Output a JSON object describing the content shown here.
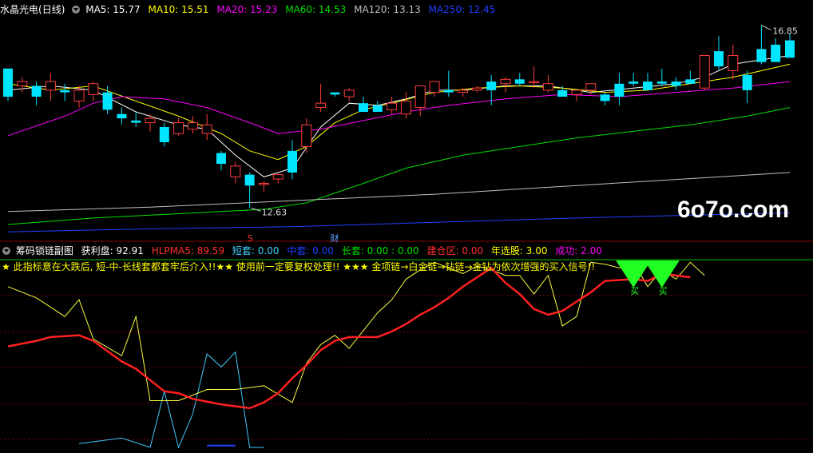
{
  "main_header": {
    "stock": "水晶光电",
    "period": "(日线)",
    "ma": [
      {
        "label": "MA5: 15.77",
        "color": "#ffffff"
      },
      {
        "label": "MA10: 15.51",
        "color": "#ffff00"
      },
      {
        "label": "MA20: 15.23",
        "color": "#ff00ff"
      },
      {
        "label": "MA60: 14.53",
        "color": "#00e000"
      },
      {
        "label": "MA120: 13.13",
        "color": "#c0c0c0"
      },
      {
        "label": "MA250: 12.45",
        "color": "#2040ff"
      }
    ]
  },
  "sub_header": {
    "name": "筹码锁链副图",
    "items": [
      {
        "label": "获利盘: 92.91",
        "color": "#ffffff"
      },
      {
        "label": "HLPMA5: 89.59",
        "color": "#ff3030"
      },
      {
        "label": "短套: 0.00",
        "color": "#40d0ff"
      },
      {
        "label": "中套: 0.00",
        "color": "#2040ff"
      },
      {
        "label": "长套: 0.00 : 0.00",
        "color": "#00e000"
      },
      {
        "label": "建仓区: 0.00",
        "color": "#ff3030"
      },
      {
        "label": "年选股: 3.00",
        "color": "#ffff00"
      },
      {
        "label": "成功: 2.00",
        "color": "#ff00ff"
      }
    ]
  },
  "note": "★ 此指标意在大跌后, 短-中-长线套都套牢后介入!!★★ 使用前一定要复权处理!! ★★★ 金项链→白金链→钻链→金钻为依次增强的买入信号!!",
  "watermark": "6o7o.com",
  "markers": {
    "s": "S",
    "cai": "财",
    "buy": "买"
  },
  "chart_data": {
    "type": "candlestick",
    "price_range": [
      11.9,
      17.1
    ],
    "annotations": {
      "high": "16.85",
      "low": "12.63"
    },
    "candles": [
      [
        15.85,
        15.85,
        15.1,
        15.2
      ],
      [
        15.45,
        15.65,
        15.3,
        15.55
      ],
      [
        15.45,
        15.55,
        15.0,
        15.2
      ],
      [
        15.35,
        15.75,
        15.1,
        15.55
      ],
      [
        15.35,
        15.5,
        15.1,
        15.3
      ],
      [
        15.1,
        15.45,
        14.95,
        15.35
      ],
      [
        15.25,
        15.55,
        15.1,
        15.5
      ],
      [
        15.3,
        15.45,
        14.8,
        14.9
      ],
      [
        14.8,
        14.95,
        14.55,
        14.7
      ],
      [
        14.65,
        14.85,
        14.5,
        14.6
      ],
      [
        14.6,
        14.8,
        14.4,
        14.7
      ],
      [
        14.5,
        14.6,
        14.05,
        14.15
      ],
      [
        14.35,
        14.7,
        14.3,
        14.6
      ],
      [
        14.45,
        14.75,
        14.35,
        14.6
      ],
      [
        14.35,
        14.8,
        14.2,
        14.55
      ],
      [
        13.9,
        13.95,
        13.5,
        13.65
      ],
      [
        13.35,
        13.7,
        13.2,
        13.6
      ],
      [
        13.4,
        13.45,
        12.63,
        13.15
      ],
      [
        13.2,
        13.25,
        13.0,
        13.2
      ],
      [
        13.3,
        13.45,
        13.2,
        13.4
      ],
      [
        13.95,
        14.2,
        13.3,
        13.45
      ],
      [
        14.05,
        14.7,
        13.9,
        14.55
      ],
      [
        14.95,
        15.5,
        14.85,
        15.05
      ],
      [
        15.3,
        15.3,
        15.2,
        15.25
      ],
      [
        15.2,
        15.4,
        15.1,
        15.35
      ],
      [
        15.05,
        15.2,
        14.9,
        14.85
      ],
      [
        15.0,
        15.1,
        14.95,
        14.85
      ],
      [
        14.9,
        15.2,
        14.8,
        15.05
      ],
      [
        14.8,
        15.3,
        14.7,
        15.1
      ],
      [
        14.95,
        15.35,
        14.75,
        15.45
      ],
      [
        15.3,
        15.55,
        15.2,
        15.55
      ],
      [
        15.35,
        15.8,
        15.2,
        15.3
      ],
      [
        15.3,
        15.4,
        15.2,
        15.35
      ],
      [
        15.35,
        15.45,
        15.3,
        15.4
      ],
      [
        15.55,
        15.7,
        15.0,
        15.35
      ],
      [
        15.5,
        15.65,
        15.3,
        15.6
      ],
      [
        15.6,
        15.75,
        15.45,
        15.5
      ],
      [
        15.55,
        15.9,
        15.4,
        15.55
      ],
      [
        15.35,
        15.7,
        15.3,
        15.5
      ],
      [
        15.35,
        15.45,
        15.2,
        15.2
      ],
      [
        15.25,
        15.35,
        15.1,
        15.35
      ],
      [
        15.35,
        15.4,
        15.25,
        15.5
      ],
      [
        15.25,
        15.3,
        15.0,
        15.1
      ],
      [
        15.5,
        15.75,
        15.0,
        15.2
      ],
      [
        15.55,
        15.75,
        15.45,
        15.5
      ],
      [
        15.55,
        15.75,
        15.4,
        15.35
      ],
      [
        15.55,
        15.85,
        15.45,
        15.5
      ],
      [
        15.55,
        15.65,
        15.35,
        15.45
      ],
      [
        15.6,
        15.8,
        15.55,
        15.5
      ],
      [
        15.4,
        15.7,
        15.35,
        16.15
      ],
      [
        16.25,
        16.6,
        15.8,
        15.9
      ],
      [
        15.8,
        16.4,
        15.6,
        16.15
      ],
      [
        15.7,
        15.8,
        15.05,
        15.35
      ],
      [
        16.3,
        16.85,
        15.95,
        16.0
      ],
      [
        16.4,
        16.55,
        16.05,
        16.0
      ],
      [
        16.5,
        16.65,
        16.2,
        16.1
      ]
    ],
    "ma_lines": {
      "MA5": [
        [
          0,
          15.35
        ],
        [
          3,
          15.45
        ],
        [
          6,
          15.35
        ],
        [
          9,
          14.85
        ],
        [
          12,
          14.55
        ],
        [
          14,
          14.45
        ],
        [
          16,
          13.85
        ],
        [
          18,
          13.35
        ],
        [
          20,
          13.55
        ],
        [
          22,
          14.5
        ],
        [
          24,
          15.05
        ],
        [
          26,
          15.0
        ],
        [
          28,
          15.15
        ],
        [
          30,
          15.35
        ],
        [
          32,
          15.35
        ],
        [
          35,
          15.45
        ],
        [
          38,
          15.45
        ],
        [
          41,
          15.3
        ],
        [
          44,
          15.4
        ],
        [
          47,
          15.5
        ],
        [
          49,
          15.65
        ],
        [
          51,
          15.95
        ],
        [
          53,
          16.05
        ],
        [
          55,
          16.15
        ]
      ],
      "MA10": [
        [
          0,
          15.5
        ],
        [
          3,
          15.35
        ],
        [
          6,
          15.45
        ],
        [
          9,
          15.1
        ],
        [
          12,
          14.75
        ],
        [
          15,
          14.35
        ],
        [
          17,
          13.95
        ],
        [
          19,
          13.75
        ],
        [
          21,
          14.05
        ],
        [
          23,
          14.6
        ],
        [
          25,
          14.9
        ],
        [
          27,
          15.05
        ],
        [
          30,
          15.3
        ],
        [
          33,
          15.4
        ],
        [
          36,
          15.45
        ],
        [
          39,
          15.4
        ],
        [
          42,
          15.3
        ],
        [
          45,
          15.35
        ],
        [
          48,
          15.5
        ],
        [
          51,
          15.65
        ],
        [
          53,
          15.8
        ],
        [
          55,
          15.95
        ]
      ],
      "MA20": [
        [
          0,
          14.3
        ],
        [
          4,
          14.75
        ],
        [
          6,
          15.05
        ],
        [
          8,
          15.2
        ],
        [
          11,
          15.15
        ],
        [
          14,
          14.95
        ],
        [
          17,
          14.6
        ],
        [
          19,
          14.35
        ],
        [
          22,
          14.45
        ],
        [
          25,
          14.65
        ],
        [
          28,
          14.85
        ],
        [
          31,
          15.0
        ],
        [
          35,
          15.15
        ],
        [
          39,
          15.25
        ],
        [
          43,
          15.2
        ],
        [
          47,
          15.3
        ],
        [
          51,
          15.4
        ],
        [
          55,
          15.55
        ]
      ],
      "MA60": [
        [
          0,
          12.25
        ],
        [
          6,
          12.4
        ],
        [
          12,
          12.5
        ],
        [
          18,
          12.6
        ],
        [
          21,
          12.75
        ],
        [
          25,
          13.2
        ],
        [
          28,
          13.55
        ],
        [
          32,
          13.85
        ],
        [
          36,
          14.05
        ],
        [
          40,
          14.25
        ],
        [
          44,
          14.4
        ],
        [
          48,
          14.55
        ],
        [
          52,
          14.75
        ],
        [
          55,
          14.95
        ]
      ],
      "MA120": [
        [
          0,
          12.55
        ],
        [
          10,
          12.65
        ],
        [
          20,
          12.8
        ],
        [
          30,
          12.95
        ],
        [
          40,
          13.15
        ],
        [
          50,
          13.35
        ],
        [
          55,
          13.45
        ]
      ],
      "MA250": [
        [
          0,
          12.08
        ],
        [
          10,
          12.15
        ],
        [
          20,
          12.2
        ],
        [
          30,
          12.3
        ],
        [
          40,
          12.4
        ],
        [
          50,
          12.48
        ],
        [
          55,
          12.52
        ]
      ]
    },
    "sub_range": [
      0,
      100
    ],
    "profit_plate": [
      [
        0,
        86
      ],
      [
        2,
        80
      ],
      [
        4,
        70
      ],
      [
        5,
        79
      ],
      [
        6,
        58
      ],
      [
        8,
        49
      ],
      [
        9,
        70
      ],
      [
        10,
        25
      ],
      [
        12,
        25
      ],
      [
        14,
        31
      ],
      [
        16,
        31
      ],
      [
        18,
        33
      ],
      [
        20,
        24
      ],
      [
        21,
        45
      ],
      [
        22,
        55
      ],
      [
        23,
        60
      ],
      [
        24,
        53
      ],
      [
        26,
        72
      ],
      [
        27,
        79
      ],
      [
        28,
        90
      ],
      [
        29,
        95
      ],
      [
        30,
        99
      ],
      [
        31,
        96
      ],
      [
        32,
        93
      ],
      [
        33,
        97
      ],
      [
        34,
        95
      ],
      [
        35,
        92
      ],
      [
        36,
        92
      ],
      [
        37,
        82
      ],
      [
        38,
        92
      ],
      [
        39,
        65
      ],
      [
        40,
        70
      ],
      [
        41,
        99
      ],
      [
        42,
        98
      ],
      [
        43,
        96
      ],
      [
        44,
        99
      ],
      [
        45,
        86
      ],
      [
        46,
        95
      ],
      [
        47,
        90
      ],
      [
        48,
        99
      ],
      [
        49,
        92
      ]
    ],
    "hlpma5": [
      [
        0,
        54
      ],
      [
        2,
        57
      ],
      [
        3,
        59
      ],
      [
        5,
        60
      ],
      [
        6,
        57
      ],
      [
        8,
        46
      ],
      [
        9,
        42
      ],
      [
        10,
        36
      ],
      [
        11,
        30
      ],
      [
        12,
        29
      ],
      [
        13,
        26
      ],
      [
        15,
        23
      ],
      [
        16,
        22
      ],
      [
        17,
        21
      ],
      [
        18,
        24
      ],
      [
        19,
        29
      ],
      [
        20,
        37
      ],
      [
        21,
        44
      ],
      [
        22,
        52
      ],
      [
        23,
        57
      ],
      [
        24,
        59
      ],
      [
        26,
        59
      ],
      [
        27,
        62
      ],
      [
        28,
        66
      ],
      [
        29,
        71
      ],
      [
        30,
        75
      ],
      [
        31,
        80
      ],
      [
        32,
        86
      ],
      [
        33,
        91
      ],
      [
        34,
        96
      ],
      [
        35,
        88
      ],
      [
        36,
        82
      ],
      [
        37,
        74
      ],
      [
        38,
        71
      ],
      [
        39,
        73
      ],
      [
        41,
        83
      ],
      [
        42,
        89
      ],
      [
        44,
        90
      ],
      [
        45,
        89
      ],
      [
        46,
        93
      ],
      [
        48,
        91
      ]
    ],
    "short_trap": [
      [
        5,
        2
      ],
      [
        8,
        5
      ],
      [
        10,
        0
      ],
      [
        11,
        30
      ],
      [
        12,
        0
      ],
      [
        13,
        18
      ],
      [
        14,
        50
      ],
      [
        15,
        43
      ],
      [
        16,
        51
      ],
      [
        17,
        0
      ],
      [
        18,
        0
      ]
    ],
    "mid_trap": [
      [
        14,
        1
      ],
      [
        16,
        1
      ]
    ],
    "buy_signal_bars": [
      44,
      46
    ]
  }
}
